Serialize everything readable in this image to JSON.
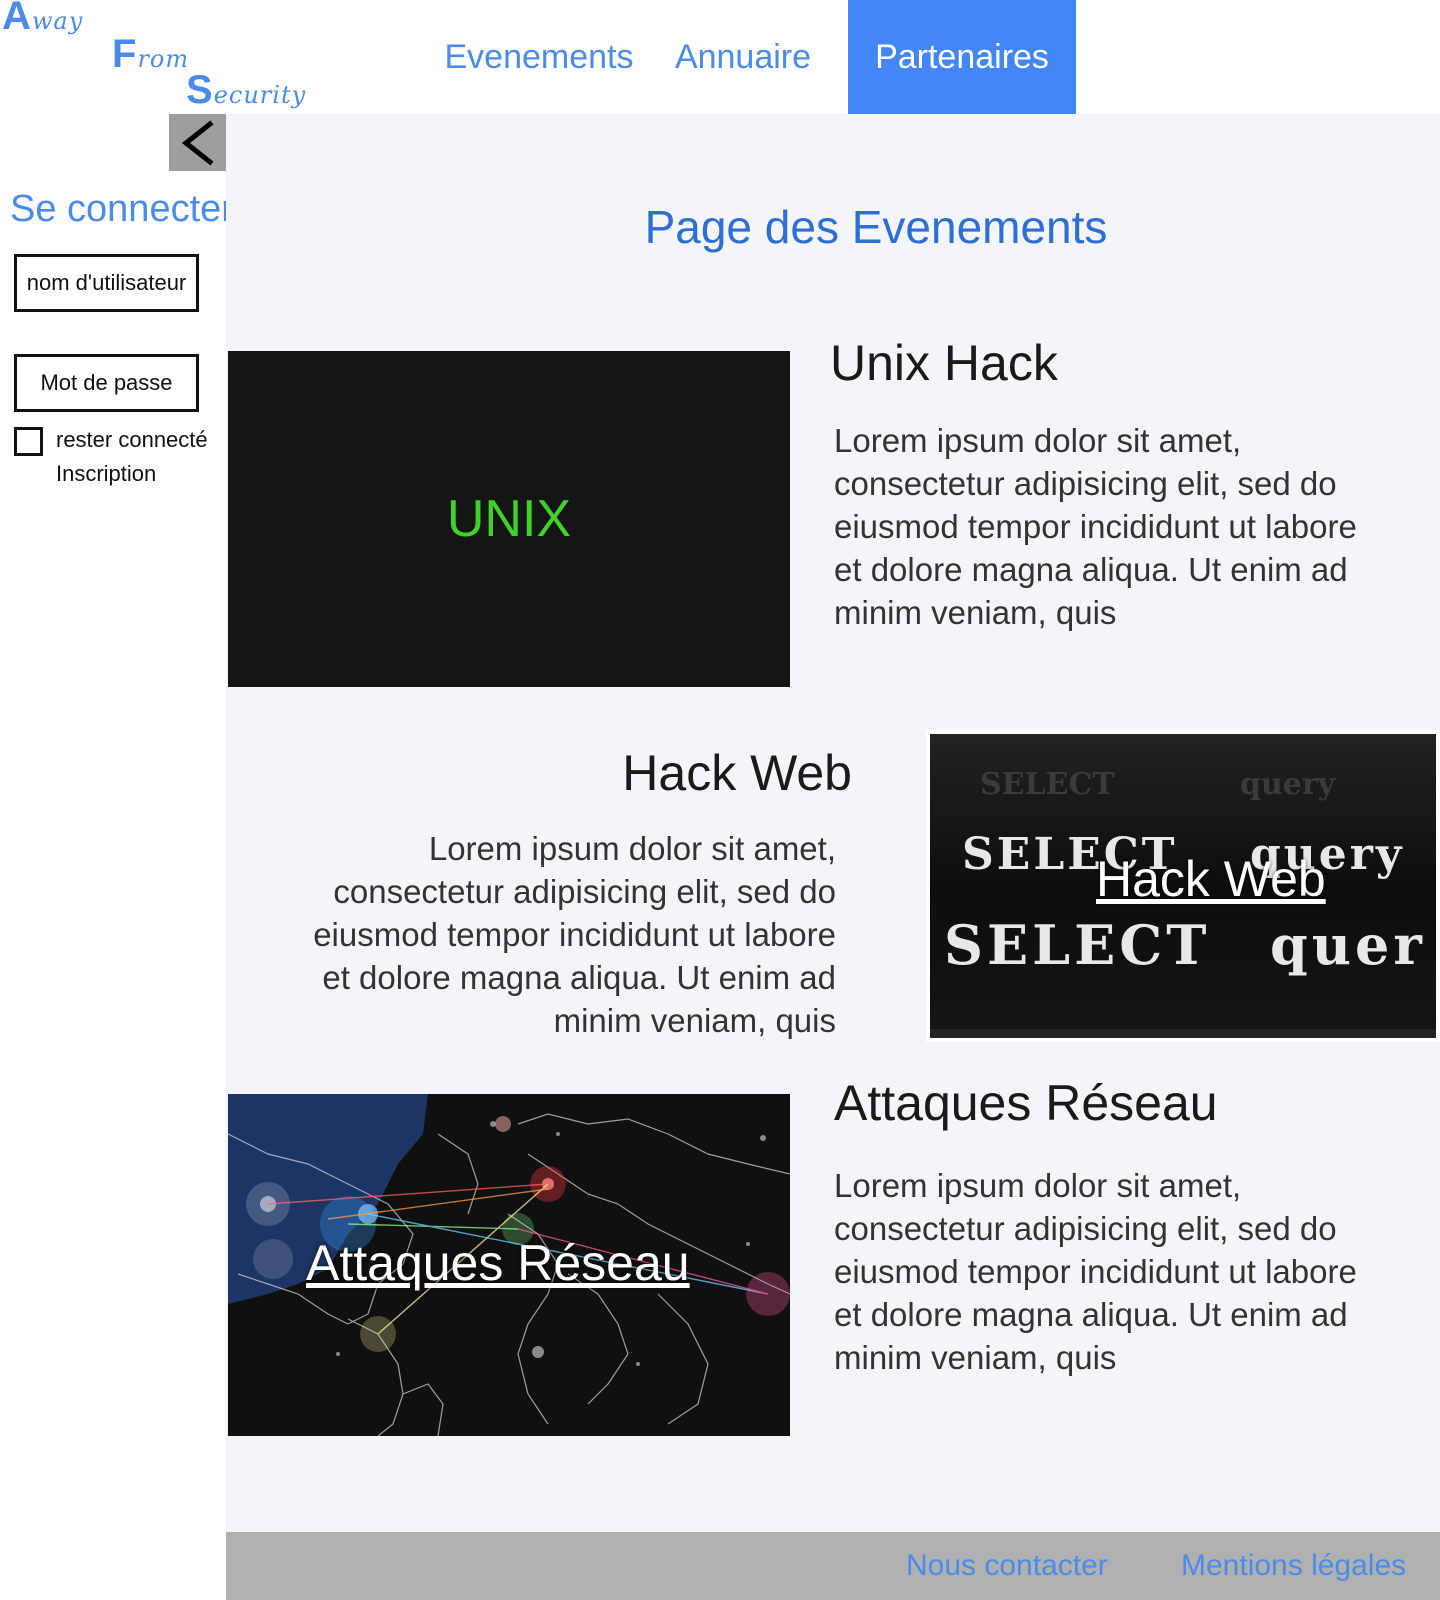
{
  "brand": {
    "line1_big": "A",
    "line1_small": "way",
    "line2_big": "F",
    "line2_small": "rom",
    "line3_big": "S",
    "line3_small": "ecurity"
  },
  "nav": {
    "items": [
      {
        "label": "Evenements"
      },
      {
        "label": "Annuaire"
      },
      {
        "label": "Partenaires",
        "active": true
      }
    ]
  },
  "sidebar": {
    "toggle_icon": "chevron-left-icon",
    "login_title": "Se connecter",
    "username_placeholder": "nom d'utilisateur",
    "password_placeholder": "Mot de passe",
    "remember_label": "rester connecté",
    "remember_checked": false,
    "signup_label": "Inscription"
  },
  "main": {
    "page_title": "Page des Evenements",
    "events": [
      {
        "title": "Unix Hack",
        "image_label": "UNIX",
        "text": "Lorem ipsum dolor sit amet, consectetur adipisicing elit, sed do eiusmod tempor incididunt ut labore et dolore magna aliqua. Ut enim ad minim veniam, quis"
      },
      {
        "title": "Hack Web",
        "image_label": "Hack Web",
        "image_code_1": "SELECT query",
        "image_code_2": "SELECT quer",
        "text": "Lorem ipsum dolor sit amet, consectetur adipisicing elit, sed do eiusmod tempor incididunt ut labore et dolore magna aliqua. Ut enim ad minim veniam, quis"
      },
      {
        "title": "Attaques Réseau",
        "image_label": "Attaques Réseau",
        "text": "Lorem ipsum dolor sit amet, consectetur adipisicing elit, sed do eiusmod tempor incididunt ut labore et dolore magna aliqua. Ut enim ad minim veniam, quis"
      }
    ]
  },
  "footer": {
    "contact": "Nous contacter",
    "legal": "Mentions légales"
  },
  "colors": {
    "accent": "#4a8ce8",
    "active_nav": "#4287f5",
    "main_bg": "#f3f5f8",
    "footer_bg": "#b0b0b0",
    "unix_green": "#3fd22a"
  }
}
